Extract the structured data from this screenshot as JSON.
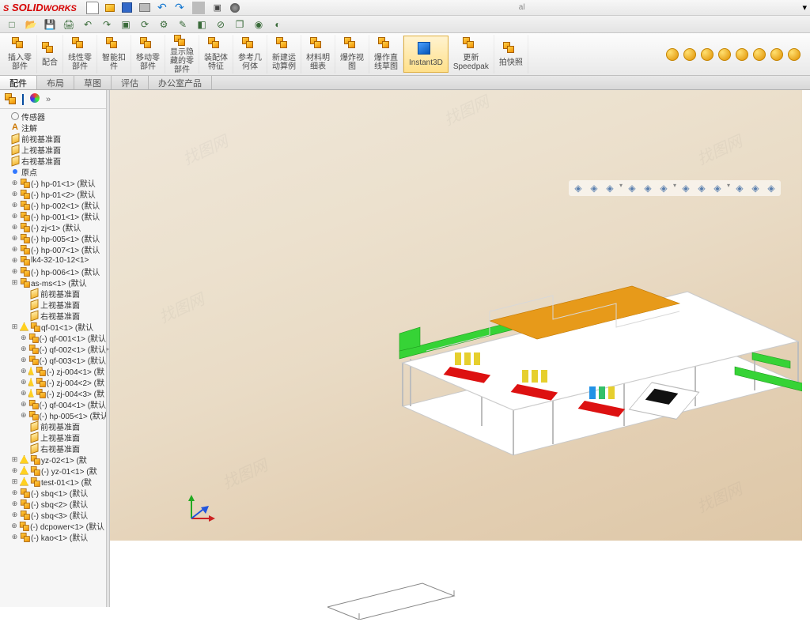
{
  "app": {
    "name": "SOLIDWORKS",
    "doc_title": "al",
    "dropdown_glyph": "▾"
  },
  "qat_icons": [
    "new",
    "open",
    "save",
    "print",
    "undo",
    "redo",
    "select",
    "rebuild",
    "options",
    "sketch",
    "feature",
    "mate",
    "component",
    "appearance",
    "display"
  ],
  "ribbon": {
    "buttons": [
      {
        "id": "insert-part",
        "label": "插入零\n部件"
      },
      {
        "id": "mate",
        "label": "配合"
      },
      {
        "id": "linear-pattern",
        "label": "线性零\n部件"
      },
      {
        "id": "smart-fasteners",
        "label": "智能扣\n件"
      },
      {
        "id": "move-comp",
        "label": "移动零\n部件"
      },
      {
        "id": "show-hidden",
        "label": "显示隐\n藏的零\n部件"
      },
      {
        "id": "asm-feature",
        "label": "装配体\n特征"
      },
      {
        "id": "ref-geom",
        "label": "参考几\n何体"
      },
      {
        "id": "new-motion",
        "label": "新建运\n动算例"
      },
      {
        "id": "bom",
        "label": "材料明\n细表"
      },
      {
        "id": "exploded",
        "label": "爆炸视\n图"
      },
      {
        "id": "explode-sketch",
        "label": "爆作直\n线草图"
      },
      {
        "id": "instant3d",
        "label": "Instant3D",
        "selected": true
      },
      {
        "id": "speedpak",
        "label": "更新\nSpeedpak"
      },
      {
        "id": "snapshot",
        "label": "拍快照"
      }
    ],
    "right_icons": [
      "appearance",
      "scene",
      "decal",
      "display-style",
      "section",
      "lights",
      "camera",
      "probe"
    ]
  },
  "tabs": [
    {
      "id": "assembly",
      "label": "配件",
      "active": true
    },
    {
      "id": "layout",
      "label": "布局"
    },
    {
      "id": "sketch",
      "label": "草图"
    },
    {
      "id": "evaluate",
      "label": "评估"
    },
    {
      "id": "office",
      "label": "办公室产品"
    }
  ],
  "view_toolbar": [
    "zoom-fit",
    "zoom-area",
    "prev-view",
    "section",
    "view-orient",
    "display-style",
    "hide-show",
    "scene",
    "appearance",
    "perspective",
    "settings",
    "full-screen"
  ],
  "tree": {
    "top": [
      {
        "type": "sensor",
        "label": "传感器"
      },
      {
        "type": "note",
        "label": "注解"
      },
      {
        "type": "plane",
        "label": "前视基准面"
      },
      {
        "type": "plane",
        "label": "上视基准面"
      },
      {
        "type": "plane",
        "label": "右视基准面"
      },
      {
        "type": "origin",
        "label": "原点"
      }
    ],
    "items": [
      {
        "label": "(-) hp-01<1> (默认"
      },
      {
        "label": "(-) hp-01<2> (默认"
      },
      {
        "label": "(-) hp-002<1> (默认"
      },
      {
        "label": "(-) hp-001<1> (默认"
      },
      {
        "label": "(-) zj<1> (默认"
      },
      {
        "label": "(-) hp-005<1> (默认"
      },
      {
        "label": "(-) hp-007<1> (默认"
      },
      {
        "label": "lk4-32-10-12<1>"
      },
      {
        "label": "(-) hp-006<1> (默认"
      },
      {
        "label": "as-ms<1> (默认",
        "sub": true,
        "planes": true
      },
      {
        "label": "qf-01<1> (默认",
        "sub": true,
        "warn": true,
        "children": [
          {
            "label": "(-) qf-001<1> (默认"
          },
          {
            "label": "(-) qf-002<1> (默认"
          },
          {
            "label": "(-) qf-003<1> (默认"
          },
          {
            "label": "(-) zj-004<1> (默",
            "warn": true
          },
          {
            "label": "(-) zj-004<2> (默",
            "warn": true
          },
          {
            "label": "(-) zj-004<3> (默",
            "warn": true
          },
          {
            "label": "(-) qf-004<1> (默认"
          },
          {
            "label": "(-) hp-005<1> (默认"
          }
        ],
        "planes_after": true
      },
      {
        "label": "yz-02<1> (默",
        "sub": true,
        "warn": true
      },
      {
        "label": "(-) yz-01<1> (默",
        "warn": true
      },
      {
        "label": "test-01<1> (默",
        "sub": true,
        "warn": true
      },
      {
        "label": "(-) sbq<1> (默认"
      },
      {
        "label": "(-) sbq<2> (默认"
      },
      {
        "label": "(-) sbq<3> (默认"
      },
      {
        "label": "(-) dcpower<1> (默认"
      },
      {
        "label": "(-) kao<1> (默认"
      }
    ],
    "subplanes": [
      "前视基准面",
      "上视基准面",
      "右视基准面"
    ]
  },
  "watermark": "找图网"
}
